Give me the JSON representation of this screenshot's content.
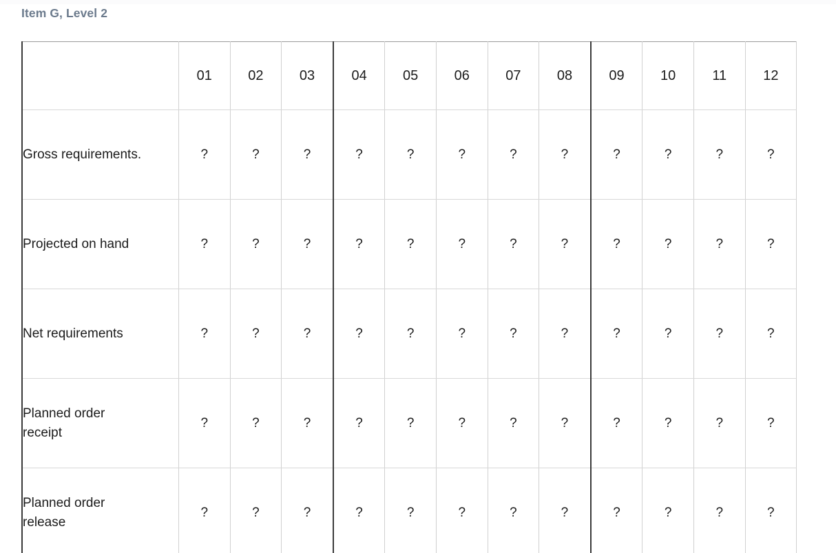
{
  "page": {
    "title": "Item G, Level 2"
  },
  "table": {
    "corner_header": "",
    "period_headers": [
      "01",
      "02",
      "03",
      "04",
      "05",
      "06",
      "07",
      "08",
      "09",
      "10",
      "11",
      "12"
    ],
    "quarter_separator_before": [
      "04",
      "09"
    ],
    "row_labels": [
      "Gross requirements.",
      "Projected on hand",
      "Net requirements",
      "Planned order receipt",
      "Planned order release"
    ],
    "cell_placeholder": "?",
    "rows": [
      {
        "label": "Gross requirements.",
        "values": [
          "?",
          "?",
          "?",
          "?",
          "?",
          "?",
          "?",
          "?",
          "?",
          "?",
          "?",
          "?"
        ]
      },
      {
        "label": "Projected on hand",
        "values": [
          "?",
          "?",
          "?",
          "?",
          "?",
          "?",
          "?",
          "?",
          "?",
          "?",
          "?",
          "?"
        ]
      },
      {
        "label": "Net requirements",
        "values": [
          "?",
          "?",
          "?",
          "?",
          "?",
          "?",
          "?",
          "?",
          "?",
          "?",
          "?",
          "?"
        ]
      },
      {
        "label": "Planned order receipt",
        "values": [
          "?",
          "?",
          "?",
          "?",
          "?",
          "?",
          "?",
          "?",
          "?",
          "?",
          "?",
          "?"
        ]
      },
      {
        "label": "Planned order release",
        "values": [
          "?",
          "?",
          "?",
          "?",
          "?",
          "?",
          "?",
          "?",
          "?",
          "?",
          "?",
          "?"
        ]
      }
    ]
  },
  "colors": {
    "title": "#6b7a8c",
    "text": "#1b1b1b",
    "grid_light": "#d8d8d8",
    "grid_dark": "#3a3a3a",
    "background": "#ffffff"
  }
}
